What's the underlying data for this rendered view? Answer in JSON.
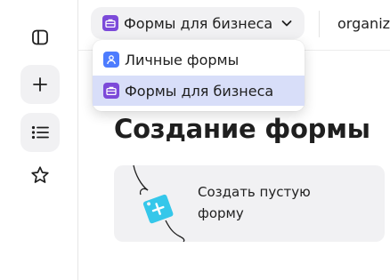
{
  "header": {
    "org_switcher": {
      "selected": "Формы для бизнеса"
    },
    "org_name": "organiz"
  },
  "dropdown": {
    "items": [
      {
        "label": "Личные формы",
        "icon": "user-icon",
        "selected": false
      },
      {
        "label": "Формы для бизнеса",
        "icon": "briefcase-icon",
        "selected": true
      }
    ]
  },
  "sidebar": {
    "items": [
      {
        "icon": "sidebar-toggle-icon"
      },
      {
        "icon": "plus-icon",
        "active": true
      },
      {
        "icon": "list-icon",
        "active": true
      },
      {
        "icon": "star-icon"
      }
    ]
  },
  "main": {
    "title": "Создание формы",
    "create_card": {
      "label": "Создать пустую форму",
      "icon": "plus-tag-icon"
    }
  },
  "colors": {
    "business_badge": "#7c4ad9",
    "personal_badge": "#4d7cfe",
    "selected_item_bg": "#d8def9",
    "tag_cyan": "#35c7ea",
    "panel_bg": "#f1f1f3"
  }
}
